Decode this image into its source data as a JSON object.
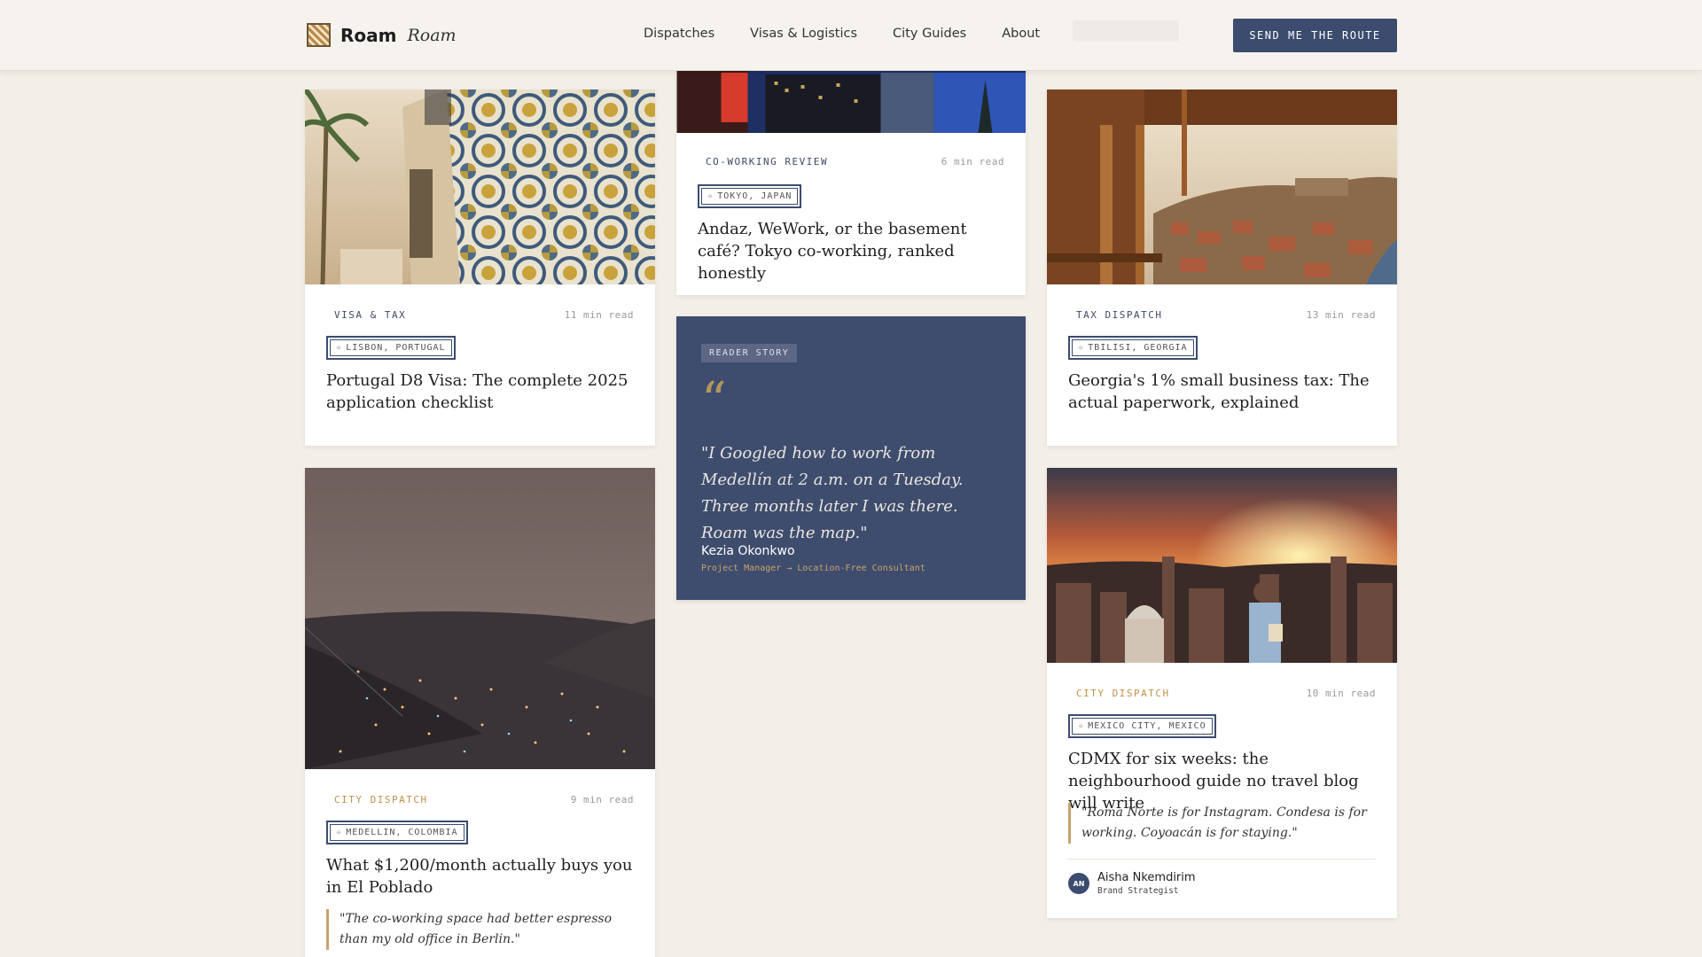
{
  "header": {
    "brand": "Roam",
    "brand_script": "Roam",
    "nav": [
      "Dispatches",
      "Visas & Logistics",
      "City Guides",
      "About"
    ],
    "cta": "SEND ME THE ROUTE"
  },
  "cards": {
    "lisbon": {
      "category": "VISA & TAX",
      "read": "11 min read",
      "location": "LISBON, PORTUGAL",
      "title": "Portugal D8 Visa: The complete 2025 application checklist"
    },
    "tokyo": {
      "category": "CO-WORKING REVIEW",
      "read": "6 min read",
      "location": "TOKYO, JAPAN",
      "title": "Andaz, WeWork, or the basement café? Tokyo co-working, ranked honestly"
    },
    "tbilisi": {
      "category": "TAX DISPATCH",
      "read": "13 min read",
      "location": "TBILISI, GEORGIA",
      "title": "Georgia's 1% small business tax: The actual paperwork, explained"
    },
    "medellin": {
      "category": "CITY DISPATCH",
      "read": "9 min read",
      "location": "MEDELLIN, COLOMBIA",
      "title": "What $1,200/month actually buys you in El Poblado",
      "quote": "\"The co-working space had better espresso than my old office in Berlin.\""
    },
    "cdmx": {
      "category": "CITY DISPATCH",
      "read": "10 min read",
      "location": "MEXICO CITY, MEXICO",
      "title": "CDMX for six weeks: the neighbourhood guide no travel blog will write",
      "quote": "\"Roma Norte is for Instagram. Condesa is for working. Coyoacán is for staying.\"",
      "author_initials": "AN",
      "author_name": "Aisha Nkemdirim",
      "author_role": "Brand Strategist"
    }
  },
  "story": {
    "badge": "READER STORY",
    "quote_mark": "“",
    "text": "\"I Googled how to work from Medellín at 2 a.m. on a Tuesday. Three months later I was there. Roam was the map.\"",
    "name": "Kezia Okonkwo",
    "role": "Project Manager → Location-Free Consultant"
  },
  "colors": {
    "accent_navy": "#3c4c6e",
    "accent_gold": "#c2914a",
    "background": "#f3efe8"
  }
}
